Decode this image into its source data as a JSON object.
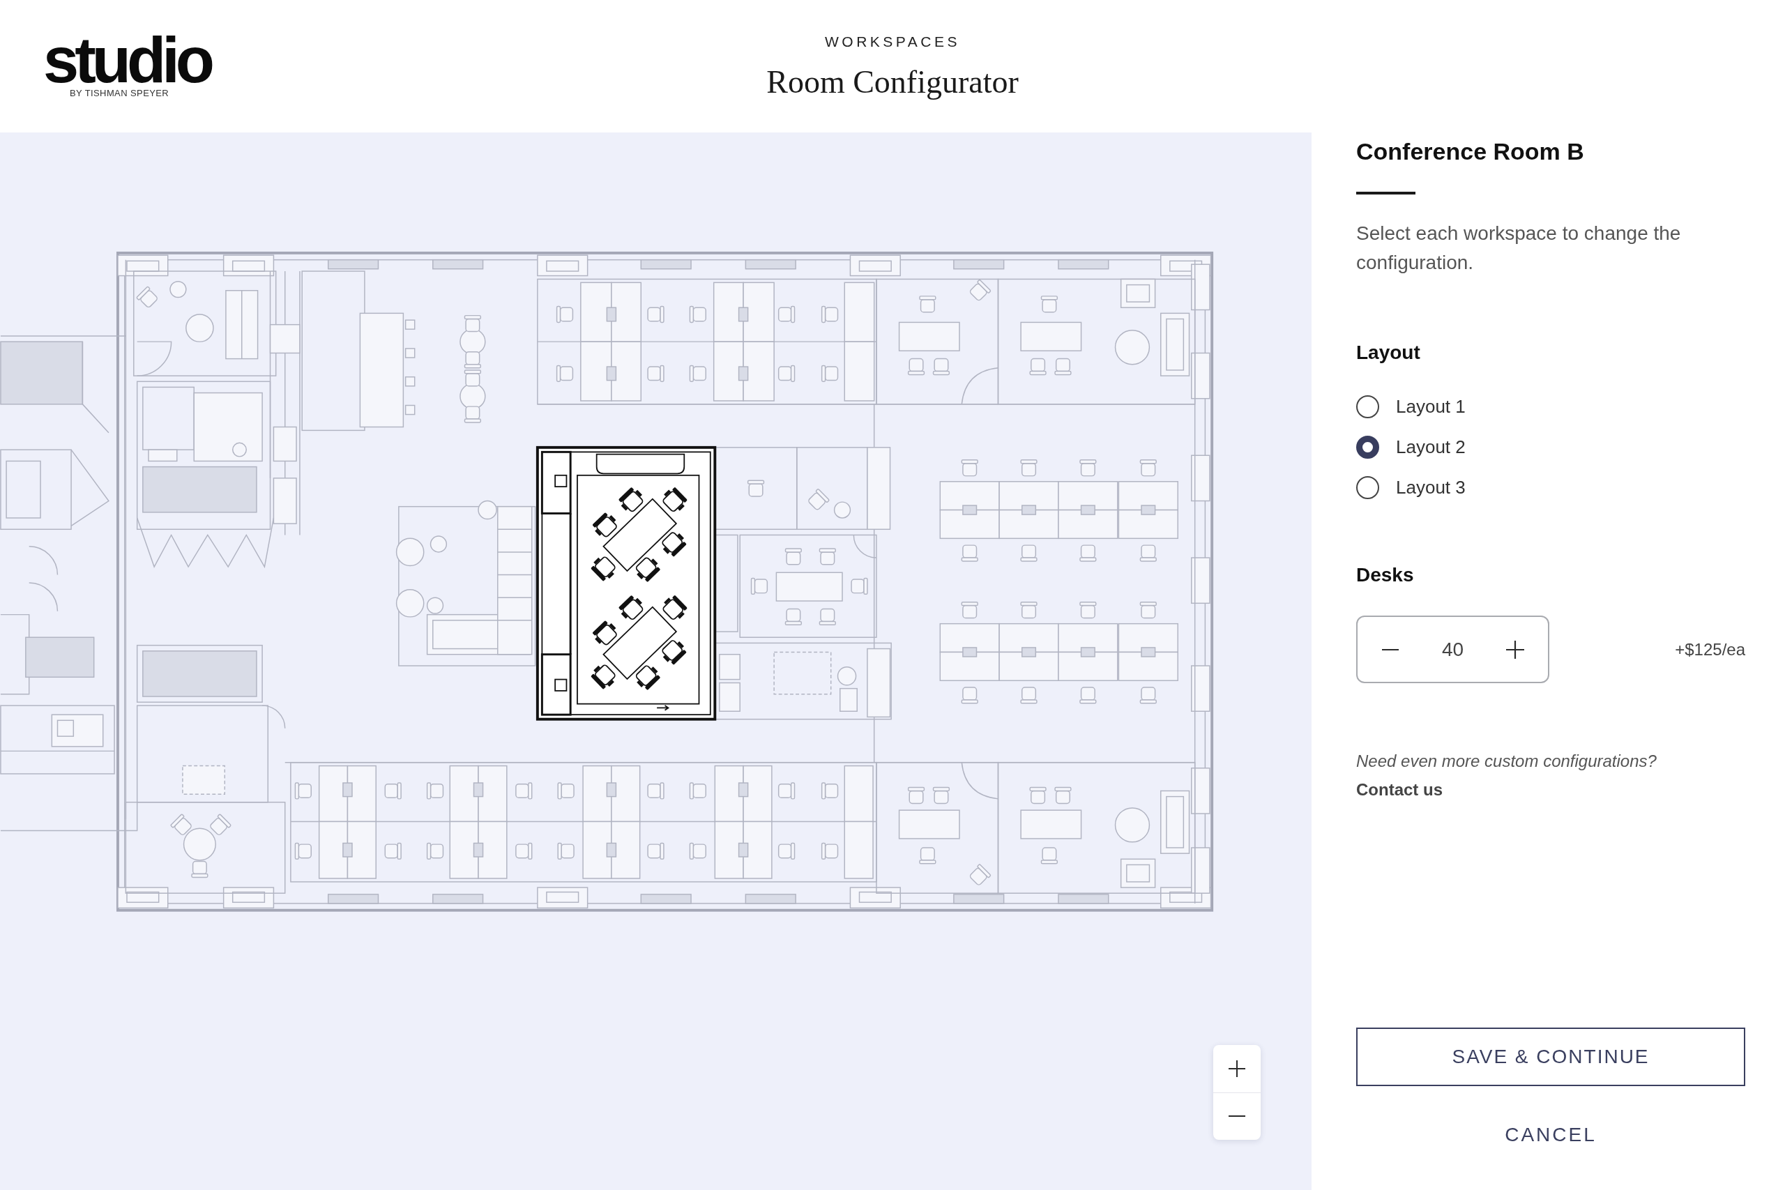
{
  "header": {
    "logo": {
      "wordmark": "studio",
      "tagline": "BY TISHMAN SPEYER"
    },
    "eyebrow": "WORKSPACES",
    "title": "Room Configurator"
  },
  "panel": {
    "title": "Conference Room B",
    "description": "Select each workspace to change the configuration.",
    "layout": {
      "label": "Layout",
      "options": [
        {
          "label": "Layout 1",
          "selected": false
        },
        {
          "label": "Layout 2",
          "selected": true
        },
        {
          "label": "Layout 3",
          "selected": false
        }
      ]
    },
    "desks": {
      "label": "Desks",
      "value": "40",
      "price": "+$125/ea"
    },
    "help": {
      "text": "Need even more custom configurations?",
      "link": "Contact us"
    },
    "buttons": [
      {
        "label": "SAVE & CONTINUE",
        "kind": "outlined"
      },
      {
        "label": "CANCEL",
        "kind": "text"
      }
    ]
  }
}
